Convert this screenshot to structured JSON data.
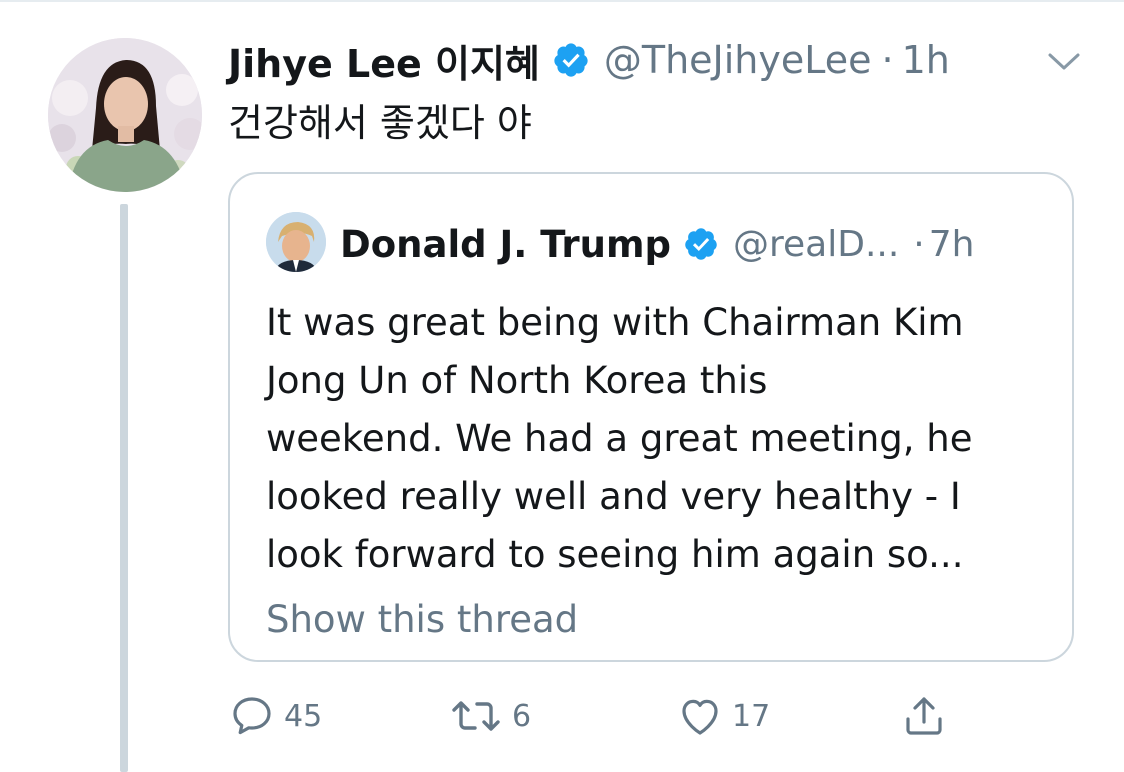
{
  "tweet": {
    "author": {
      "display_name": "Jihye Lee 이지혜",
      "handle": "@TheJihyeLee",
      "verified": true,
      "avatar_icon": "profile-photo"
    },
    "separator": "·",
    "time": "1h",
    "text": "건강해서 좋겠다 야",
    "menu_icon": "chevron-down-icon"
  },
  "quoted_tweet": {
    "author": {
      "display_name": "Donald J. Trump",
      "handle": "@realD...",
      "verified": true,
      "avatar_icon": "profile-photo"
    },
    "separator": "·",
    "time": "7h",
    "text_lines": [
      "It was great being with Chairman Kim",
      "Jong Un of North Korea this",
      "weekend. We had a great meeting, he",
      "looked really well and very healthy - I",
      "look forward to seeing him again so..."
    ],
    "show_thread_label": "Show this thread"
  },
  "actions": {
    "reply": {
      "icon": "reply-icon",
      "count": "45"
    },
    "retweet": {
      "icon": "retweet-icon",
      "count": "6"
    },
    "like": {
      "icon": "heart-icon",
      "count": "17"
    },
    "share": {
      "icon": "share-icon"
    }
  },
  "colors": {
    "text_primary": "#14171a",
    "text_secondary": "#657786",
    "verified_blue": "#1da1f2",
    "border": "#ccd6dd"
  }
}
